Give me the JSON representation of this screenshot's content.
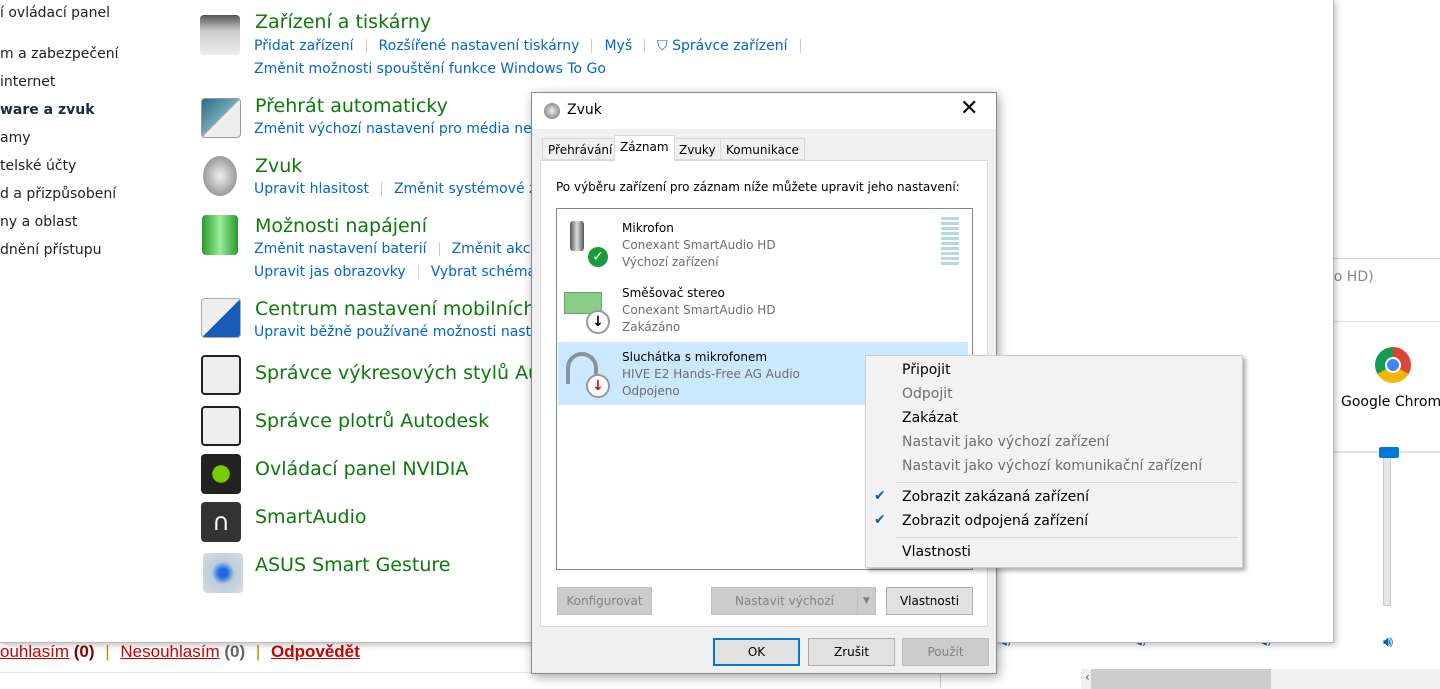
{
  "sidebar": {
    "items": [
      {
        "label": "í ovládací panel"
      },
      {
        "label": "m a zabezpečení"
      },
      {
        "label": "internet"
      },
      {
        "label": "ware a zvuk"
      },
      {
        "label": "amy"
      },
      {
        "label": "telské účty"
      },
      {
        "label": "d a přizpůsobení"
      },
      {
        "label": "ny a oblast"
      },
      {
        "label": "dnění přístupu"
      }
    ]
  },
  "categories": [
    {
      "title": "Zařízení a tiskárny",
      "links": [
        "Přidat zařízení",
        "Rozšířené nastavení tiskárny",
        "Myš",
        "Správce zařízení"
      ],
      "links2": [
        "Změnit možnosti spouštění funkce Windows To Go"
      ]
    },
    {
      "title": "Přehrát automaticky",
      "links": [
        "Změnit výchozí nastavení pro média nebo"
      ]
    },
    {
      "title": "Zvuk",
      "links": [
        "Upravit hlasitost",
        "Změnit systémové zvu"
      ]
    },
    {
      "title": "Možnosti napájení",
      "links": [
        "Změnit nastavení baterií",
        "Změnit akce t"
      ],
      "links2": [
        "Upravit jas obrazovky",
        "Vybrat schéma n"
      ]
    },
    {
      "title": "Centrum nastavení mobilních za",
      "links": [
        "Upravit běžně používané možnosti nastave"
      ]
    },
    {
      "title": "Správce výkresových stylů Auto"
    },
    {
      "title": "Správce plotrů Autodesk"
    },
    {
      "title": "Ovládací panel NVIDIA"
    },
    {
      "title": "SmartAudio"
    },
    {
      "title": "ASUS Smart Gesture"
    }
  ],
  "comment": {
    "agree": "ouhlasím",
    "agree_count": "(0)",
    "disagree": "Nesouhlasím",
    "disagree_count": "(0)",
    "reply": "Odpovědět",
    "sep": "|"
  },
  "mixer": {
    "device": "dio HD)",
    "app": "Google Chrome",
    "volume_percent": 100
  },
  "dialog": {
    "title": "Zvuk",
    "tabs": [
      "Přehrávání",
      "Záznam",
      "Zvuky",
      "Komunikace"
    ],
    "active_tab": "Záznam",
    "instruction": "Po výběru zařízení pro záznam níže můžete upravit jeho nastavení:",
    "devices": [
      {
        "name": "Mikrofon",
        "driver": "Conexant SmartAudio HD",
        "status": "Výchozí zařízení"
      },
      {
        "name": "Směšovač stereo",
        "driver": "Conexant SmartAudio HD",
        "status": "Zakázáno"
      },
      {
        "name": "Sluchátka s mikrofonem",
        "driver": "HIVE E2 Hands-Free AG Audio",
        "status": "Odpojeno"
      }
    ],
    "buttons": {
      "configure": "Konfigurovat",
      "set_default": "Nastavit výchozí",
      "properties": "Vlastnosti",
      "ok": "OK",
      "cancel": "Zrušit",
      "apply": "Použít"
    }
  },
  "context_menu": {
    "items": [
      "Připojit",
      "Odpojit",
      "Zakázat",
      "Nastavit jako výchozí zařízení",
      "Nastavit jako výchozí komunikační zařízení",
      "Zobrazit zakázaná zařízení",
      "Zobrazit odpojená zařízení",
      "Vlastnosti"
    ]
  },
  "colors": {
    "category_title": "#0a7a0a",
    "link": "#0066cc",
    "selection": "#cce8ff",
    "accent": "#0078d7"
  }
}
